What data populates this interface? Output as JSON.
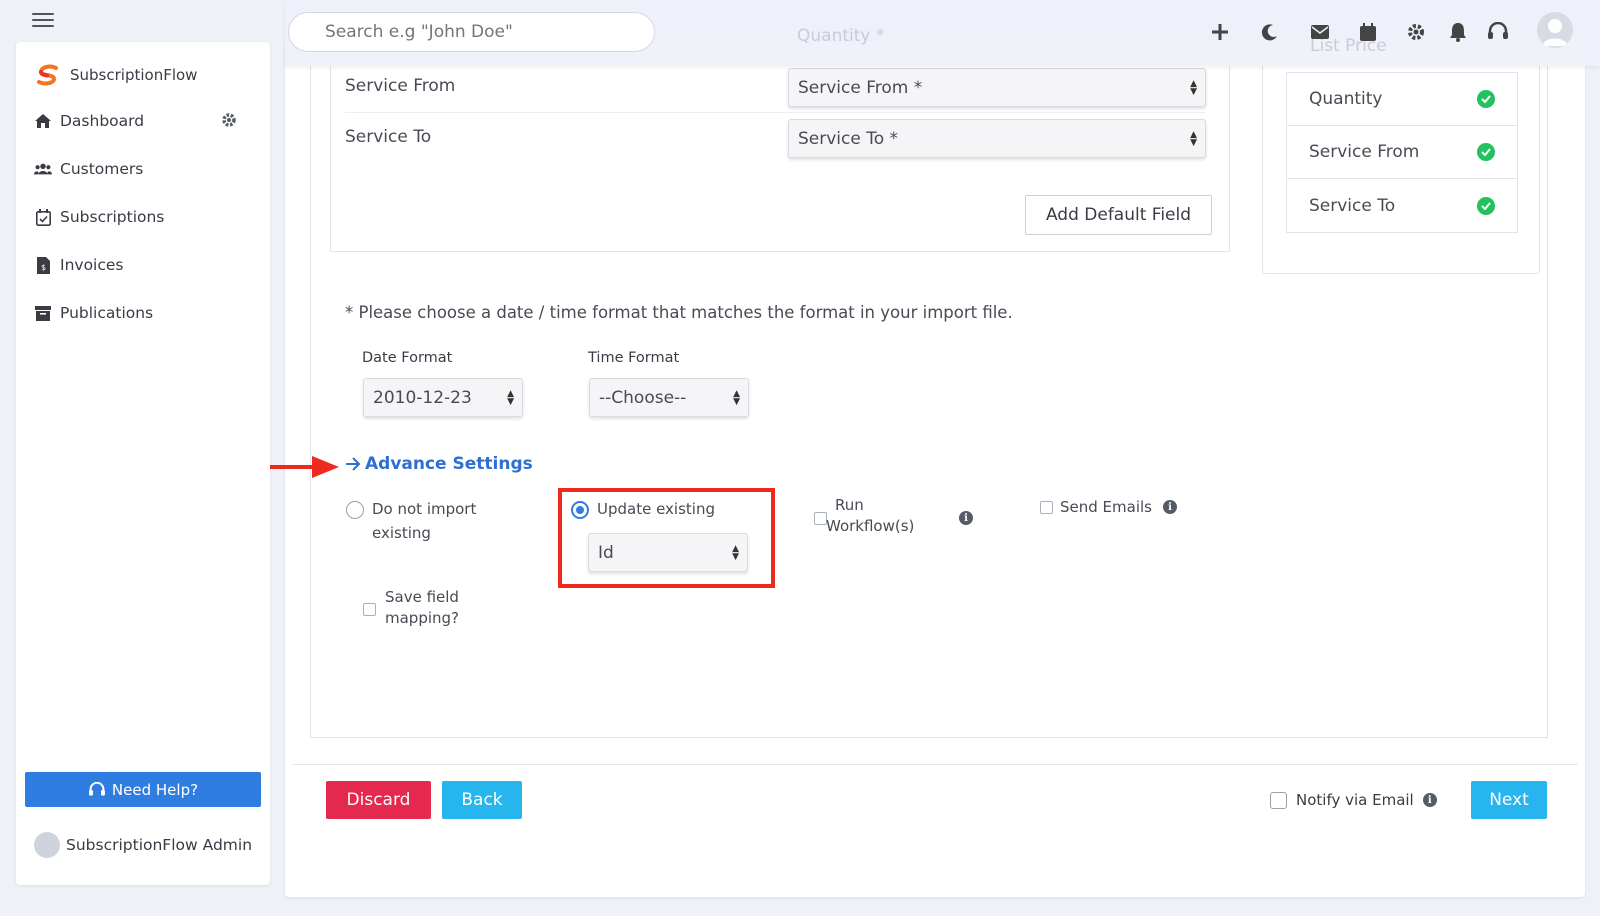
{
  "topbar": {
    "search_placeholder": "Search e.g \"John Doe\"",
    "ghost_quantity": "Quantity *",
    "ghost_list_price": "List Price"
  },
  "sidebar": {
    "brand": "SubscriptionFlow",
    "items": [
      {
        "label": "Dashboard",
        "icon": "home-icon"
      },
      {
        "label": "Customers",
        "icon": "users-icon"
      },
      {
        "label": "Subscriptions",
        "icon": "calendar-check-icon"
      },
      {
        "label": "Invoices",
        "icon": "file-invoice-icon"
      },
      {
        "label": "Publications",
        "icon": "archive-icon"
      }
    ],
    "need_help": "Need Help?",
    "user": "SubscriptionFlow Admin"
  },
  "mapping": {
    "rows": [
      {
        "label": "Service From",
        "select": "Service From *"
      },
      {
        "label": "Service To",
        "select": "Service To *"
      }
    ],
    "add_default_field": "Add Default Field"
  },
  "mapped_fields": [
    {
      "label": "Quantity"
    },
    {
      "label": "Service From"
    },
    {
      "label": "Service To"
    }
  ],
  "format": {
    "note": "* Please choose a date / time format that matches the format in your import file.",
    "date_label": "Date Format",
    "date_value": "2010-12-23",
    "time_label": "Time Format",
    "time_value": "--Choose--"
  },
  "advance": {
    "title": "Advance Settings",
    "do_not_import_line1": "Do not import",
    "do_not_import_line2": "existing",
    "update_existing": "Update existing",
    "update_key": "Id",
    "run_workflow_line1": "Run",
    "run_workflow_line2": "Workflow(s)",
    "send_emails": "Send Emails",
    "save_mapping_line1": "Save field",
    "save_mapping_line2": "mapping?"
  },
  "footer": {
    "discard": "Discard",
    "back": "Back",
    "notify": "Notify via Email",
    "next": "Next"
  },
  "colors": {
    "primary": "#2f7de1",
    "discard": "#e5294e",
    "info": "#27b5ee",
    "success": "#22c35e",
    "highlight": "#ee2a1f"
  }
}
